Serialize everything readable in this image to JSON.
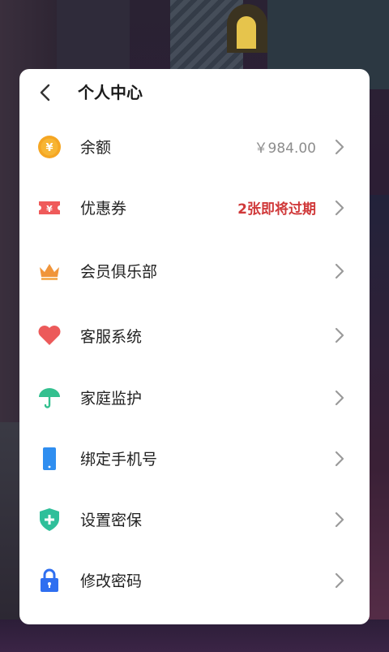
{
  "header": {
    "title": "个人中心"
  },
  "items": [
    {
      "id": "balance",
      "label": "余额",
      "value": "￥984.00",
      "value_color": "#8d8d8d",
      "icon": "yuan-coin-icon"
    },
    {
      "id": "coupons",
      "label": "优惠券",
      "value": "2张即将过期",
      "value_color": "#d0393a",
      "icon": "ticket-icon"
    },
    {
      "id": "member-club",
      "label": "会员俱乐部",
      "value": "",
      "icon": "crown-icon"
    },
    {
      "id": "customer-service",
      "label": "客服系统",
      "value": "",
      "icon": "heart-icon"
    },
    {
      "id": "family-monitor",
      "label": "家庭监护",
      "value": "",
      "icon": "umbrella-icon"
    },
    {
      "id": "bind-phone",
      "label": "绑定手机号",
      "value": "",
      "icon": "phone-icon"
    },
    {
      "id": "security-question",
      "label": "设置密保",
      "value": "",
      "icon": "shield-plus-icon"
    },
    {
      "id": "change-password",
      "label": "修改密码",
      "value": "",
      "icon": "lock-icon"
    }
  ],
  "colors": {
    "coin": "#f5a623",
    "ticket": "#ef5a5a",
    "crown": "#f0953a",
    "heart": "#ec5a5a",
    "umbrella": "#33c08f",
    "phone": "#2f8ef0",
    "shield": "#2fbf9a",
    "lock": "#2f6ff0",
    "warn_text": "#d0393a",
    "muted_text": "#8d8d8d"
  }
}
